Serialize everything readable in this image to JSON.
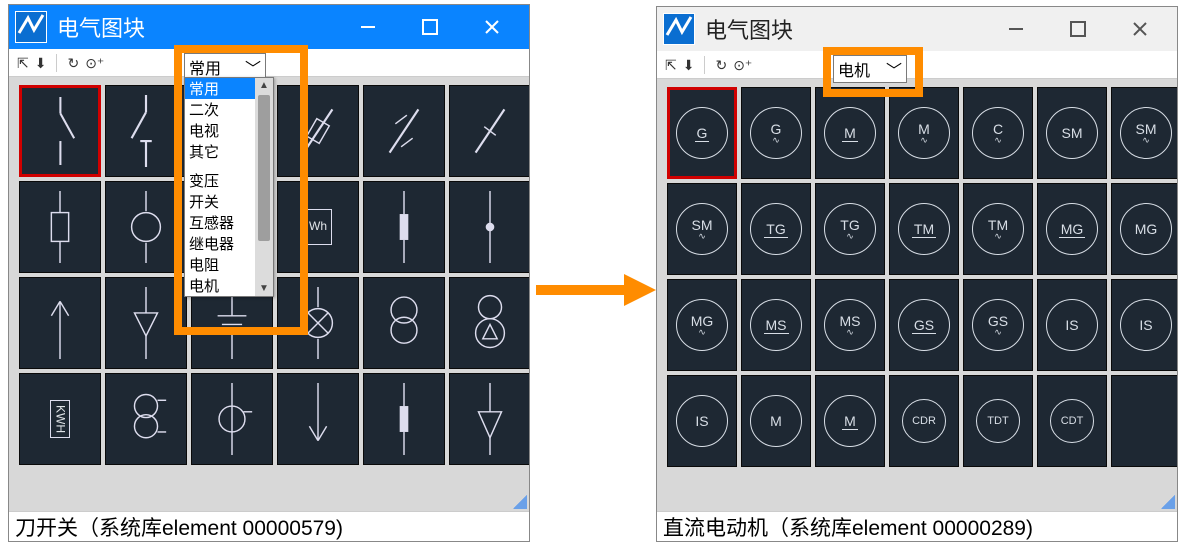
{
  "window_left": {
    "title": "电气图块",
    "active": true,
    "category_selected": "常用",
    "dropdown_options": [
      "常用",
      "二次",
      "电视",
      "其它",
      "变压",
      "开关",
      "互感器",
      "继电器",
      "电阻",
      "电机"
    ],
    "status": "刀开关（系统库element 00000579)",
    "symbols": [
      [
        "switch",
        "decorative"
      ],
      [
        "switch2",
        "decorative"
      ],
      [
        "line-circle",
        "decorative"
      ],
      [
        "fuse",
        "decorative"
      ],
      [
        "fuse2",
        "decorative"
      ],
      [
        "fuse3",
        "decorative"
      ],
      [
        "cap",
        "decorative"
      ],
      [
        "circle-line",
        "decorative"
      ],
      [
        "hidden",
        "decorative"
      ],
      [
        "wh-meter",
        "decorative"
      ],
      [
        "rect-v",
        "decorative"
      ],
      [
        "dot-v",
        "decorative"
      ],
      [
        "arrow-up",
        "decorative"
      ],
      [
        "tri-down",
        "decorative"
      ],
      [
        "ground",
        "decorative"
      ],
      [
        "lamp",
        "decorative"
      ],
      [
        "two-circ",
        "decorative"
      ],
      [
        "tri-in-circ",
        "decorative"
      ],
      [
        "kwh",
        "decorative"
      ],
      [
        "two-circ-h",
        "decorative"
      ],
      [
        "circ-h",
        "decorative"
      ],
      [
        "arrow-down",
        "decorative"
      ],
      [
        "rect-v2",
        "decorative"
      ],
      [
        "tri-down2",
        "decorative"
      ]
    ]
  },
  "window_right": {
    "title": "电气图块",
    "active": false,
    "category_selected": "电机",
    "status": "直流电动机（系统库element 00000289)",
    "symbols": [
      {
        "t": "G",
        "s": "_"
      },
      {
        "t": "G",
        "s": "~"
      },
      {
        "t": "M",
        "s": "_"
      },
      {
        "t": "M",
        "s": "~"
      },
      {
        "t": "C",
        "s": "~"
      },
      {
        "t": "SM",
        "s": ""
      },
      {
        "t": "SM",
        "s": "~"
      },
      {
        "t": "SM",
        "s": "~"
      },
      {
        "t": "TG",
        "s": "_"
      },
      {
        "t": "TG",
        "s": "~"
      },
      {
        "t": "TM",
        "s": "_"
      },
      {
        "t": "TM",
        "s": "~"
      },
      {
        "t": "MG",
        "s": "_"
      },
      {
        "t": "MG",
        "s": ""
      },
      {
        "t": "MG",
        "s": "~"
      },
      {
        "t": "MS",
        "s": "_"
      },
      {
        "t": "MS",
        "s": "~"
      },
      {
        "t": "GS",
        "s": "_"
      },
      {
        "t": "GS",
        "s": "~"
      },
      {
        "t": "IS",
        "s": ""
      },
      {
        "t": "IS",
        "s": ""
      },
      {
        "t": "IS",
        "s": ""
      },
      {
        "t": "M",
        "s": ""
      },
      {
        "t": "M",
        "s": "_"
      },
      {
        "t": "CDR",
        "s": ""
      },
      {
        "t": "TDT",
        "s": ""
      },
      {
        "t": "CDT",
        "s": ""
      },
      {
        "t": "",
        "s": ""
      }
    ]
  },
  "icons": {
    "refresh": "↻",
    "zoom": "⊕",
    "pin": "📌",
    "collapse": "▾"
  }
}
